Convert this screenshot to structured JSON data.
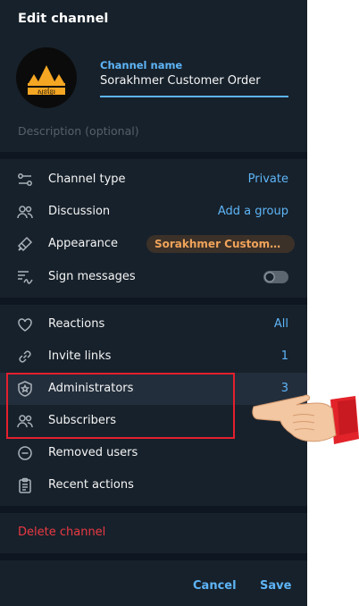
{
  "header": {
    "title": "Edit channel"
  },
  "channel": {
    "name_label": "Channel name",
    "name_value": "Sorakhmer Customer Order",
    "avatar_text": "សុខខ្មែរ",
    "description_placeholder": "Description (optional)"
  },
  "settings": {
    "channel_type": {
      "label": "Channel type",
      "value": "Private"
    },
    "discussion": {
      "label": "Discussion",
      "value": "Add a group"
    },
    "appearance": {
      "label": "Appearance",
      "value": "Sorakhmer Customer Or..."
    },
    "sign_messages": {
      "label": "Sign messages",
      "enabled": false
    }
  },
  "management": {
    "reactions": {
      "label": "Reactions",
      "value": "All"
    },
    "invite_links": {
      "label": "Invite links",
      "value": "1"
    },
    "administrators": {
      "label": "Administrators",
      "value": "3"
    },
    "subscribers": {
      "label": "Subscribers",
      "value": "7"
    },
    "removed_users": {
      "label": "Removed users"
    },
    "recent_actions": {
      "label": "Recent actions"
    }
  },
  "danger": {
    "delete_label": "Delete channel"
  },
  "footer": {
    "cancel_label": "Cancel",
    "save_label": "Save"
  },
  "colors": {
    "panel_bg": "#17212b",
    "accent": "#5eb5f7",
    "danger": "#ec3942",
    "highlight": "#e3202e",
    "appearance_pill_text": "#f0a35a"
  }
}
